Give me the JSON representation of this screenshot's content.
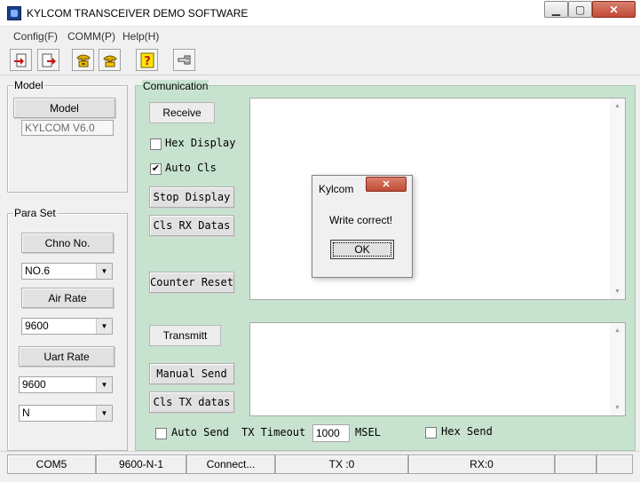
{
  "window": {
    "title": "KYLCOM TRANSCEIVER DEMO SOFTWARE"
  },
  "menu": [
    "Config(F)",
    "COMM(P)",
    "Help(H)"
  ],
  "toolbar": {
    "icons": [
      "open-port-icon",
      "close-port-icon",
      "read-params-icon",
      "write-params-icon",
      "help-icon",
      "exit-icon"
    ]
  },
  "model_group": {
    "label": "Model",
    "button": "Model",
    "value": "KYLCOM V6.0"
  },
  "para_group": {
    "label": "Para Set",
    "chno_button": "Chno No.",
    "chno_value": "NO.6",
    "air_button": "Air Rate",
    "air_value": "9600",
    "uart_button": "Uart Rate",
    "uart_value": "9600",
    "parity_value": "N"
  },
  "comm": {
    "label": "Comunication",
    "receive": "Receive",
    "hex_display": "Hex Display",
    "auto_cls": "Auto Cls",
    "stop_display": "Stop Display",
    "cls_rx": "Cls RX Datas",
    "counter_reset": "Counter Reset",
    "transmit": "Transmitt",
    "manual_send": "Manual Send",
    "cls_tx": "Cls TX datas",
    "auto_send": "Auto Send",
    "tx_timeout": "TX Timeout",
    "timeout_value": "1000",
    "msel": "MSEL",
    "hex_send": "Hex Send"
  },
  "dialog": {
    "title": "Kylcom",
    "message": "Write correct!",
    "ok": "OK"
  },
  "status": {
    "port": "COM5",
    "format": "9600-N-1",
    "state": "Connect...",
    "tx": "TX :0",
    "rx": "RX:0"
  },
  "colors": {
    "comm_bg": "#c7e3cf",
    "close_red": "#c14a36"
  }
}
